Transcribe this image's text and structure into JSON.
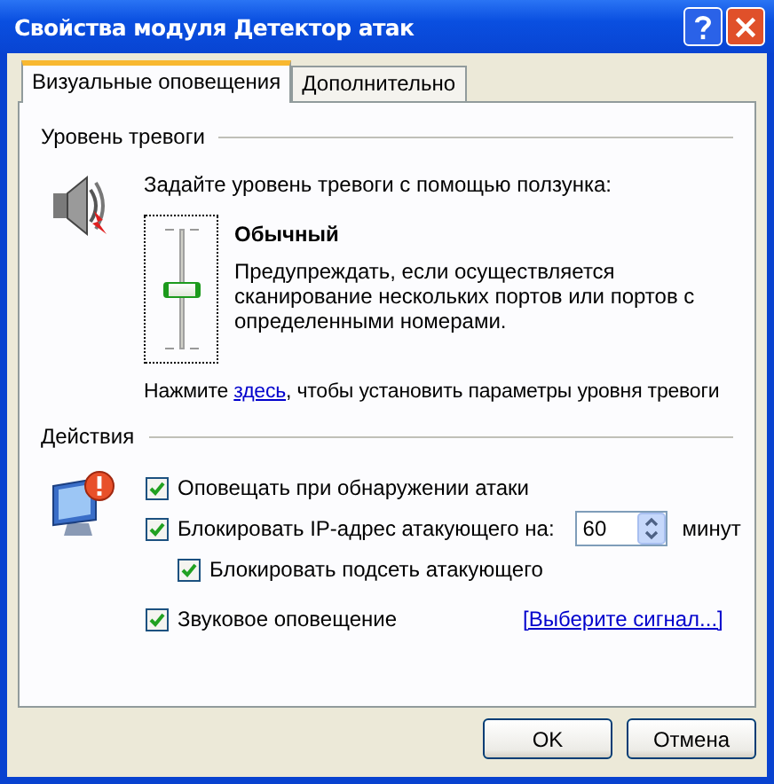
{
  "window": {
    "title": "Свойства модуля Детектор атак"
  },
  "tabs": [
    {
      "label": "Визуальные оповещения",
      "selected": true
    },
    {
      "label": "Дополнительно",
      "selected": false
    }
  ],
  "alert_level": {
    "heading": "Уровень тревоги",
    "instruction": "Задайте уровень тревоги с помощью ползунка:",
    "slider": {
      "level": 0.5
    },
    "level_name": "Обычный",
    "description": "Предупреждать, если осуществляется сканирование нескольких портов или портов с определенными номерами.",
    "hint": {
      "before": "Нажмите ",
      "link": "здесь",
      "after": ", чтобы установить параметры уровня тревоги"
    }
  },
  "actions": {
    "heading": "Действия",
    "options": [
      {
        "kind": "checkbox",
        "label": "Оповещать при обнаружении атаки",
        "checked": true
      },
      {
        "kind": "spin",
        "label": "Блокировать IP-адрес атакующего на:",
        "checked": true,
        "value": "60",
        "unit": "минут",
        "children": [
          {
            "label": "Блокировать подсеть атакующего",
            "checked": true
          }
        ]
      },
      {
        "kind": "link",
        "label": "Звуковое оповещение",
        "checked": true,
        "link": "[Выберите сигнал...]"
      }
    ]
  },
  "buttons": [
    {
      "label": "OK"
    },
    {
      "label": "Отмена"
    }
  ]
}
